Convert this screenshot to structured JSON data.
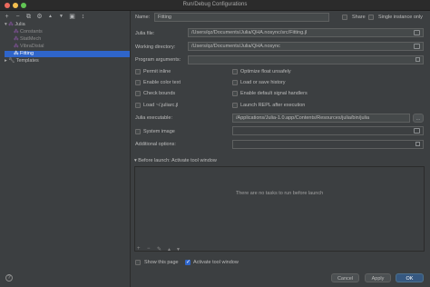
{
  "window": {
    "title": "Run/Debug Configurations"
  },
  "toolbar": {
    "add": "+",
    "remove": "−",
    "copy": "⧉",
    "settings": "⚙",
    "up": "▲",
    "down": "▼",
    "folder": "▣",
    "sort": "↕"
  },
  "tree": {
    "julia_label": "Julia",
    "children": [
      "Constants",
      "StatMech",
      "VibraDistal",
      "Fitting"
    ],
    "templates_label": "Templates"
  },
  "form": {
    "name_label": "Name:",
    "name_value": "Fitting",
    "share_label": "Share",
    "single_instance_label": "Single instance only",
    "julia_file_label": "Julia file:",
    "julia_file_value": "/Users/qz/Documents/Julia/QHA.nosync/src/Fitting.jl",
    "working_dir_label": "Working directory:",
    "working_dir_value": "/Users/qz/Documents/Julia/QHA.nosync",
    "program_args_label": "Program arguments:",
    "options": {
      "permit_inline": "Permit inline",
      "optimize_float": "Optimize float unsafely",
      "enable_color_text": "Enable color text",
      "load_save_history": "Load or save history",
      "check_bounds": "Check bounds",
      "enable_default_signal": "Enable default signal handlers",
      "load_juliarc": "Load ~/.juliarc.jl",
      "launch_repl": "Launch REPL after execution"
    },
    "julia_exec_label": "Julia executable:",
    "julia_exec_value": "/Applications/Julia-1.0.app/Contents/Resources/julia/bin/julia",
    "system_image_label": "System image",
    "additional_options_label": "Additional options:"
  },
  "before_launch": {
    "header": "Before launch: Activate tool window",
    "empty_text": "There are no tasks to run before launch",
    "add": "+",
    "remove": "−",
    "edit": "✎",
    "up": "▲",
    "down": "▼"
  },
  "footer": {
    "show_page_label": "Show this page",
    "activate_tool_label": "Activate tool window",
    "cancel": "Cancel",
    "apply": "Apply",
    "ok": "OK",
    "help": "?"
  },
  "colors": {
    "accent": "#2f65ca",
    "background": "#3c3f41",
    "field": "#45494a"
  }
}
